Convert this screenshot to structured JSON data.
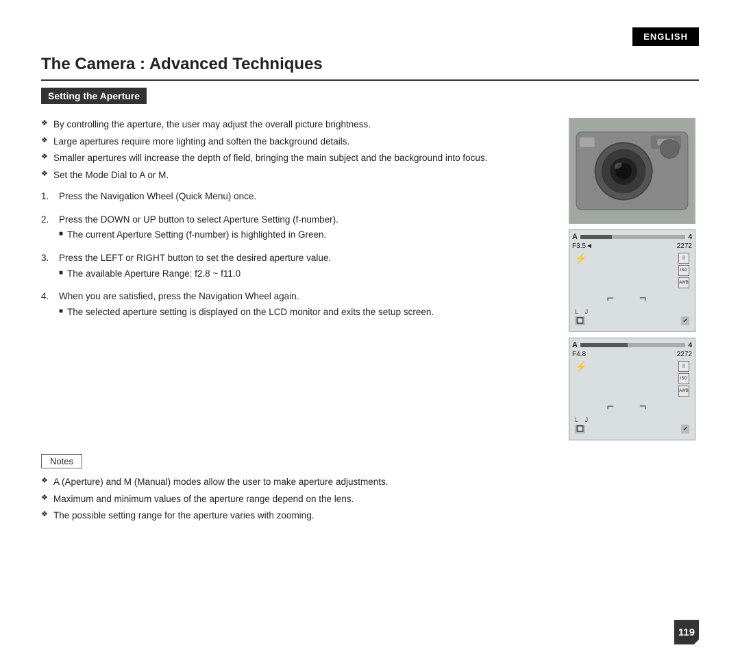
{
  "badge": {
    "label": "ENGLISH"
  },
  "page": {
    "title": "The Camera : Advanced Techniques",
    "section_heading": "Setting the Aperture"
  },
  "intro_bullets": [
    "By controlling the aperture, the user may adjust the overall picture brightness.",
    "Large apertures require more lighting and soften the background details.",
    "Smaller apertures will increase the depth of field, bringing the main subject and the background into focus.",
    "Set the Mode Dial to A or M."
  ],
  "steps": [
    {
      "num": "1.",
      "text": "Press the Navigation Wheel (Quick Menu) once.",
      "sub": null
    },
    {
      "num": "2.",
      "text": "Press the DOWN or UP button to select Aperture Setting (f-number).",
      "sub": "The current Aperture Setting (f-number) is highlighted in Green."
    },
    {
      "num": "3.",
      "text": "Press the LEFT or RIGHT button to set the desired aperture value.",
      "sub": "The available Aperture Range: f2.8 ~ f11.0"
    },
    {
      "num": "4.",
      "text": "When you are satisfied, press the Navigation Wheel again.",
      "sub": "The selected aperture setting is displayed on the LCD monitor and exits the setup screen."
    }
  ],
  "notes_label": "Notes",
  "notes_bullets": [
    "A (Aperture) and M (Manual) modes allow the user to make aperture adjustments.",
    "Maximum and minimum values of the aperture range depend on the lens.",
    "The possible setting range for the aperture varies with zooming."
  ],
  "lcd1": {
    "mode": "A",
    "bar_pct": 30,
    "number": "4",
    "fnum": "F3.5◄",
    "count": "2272",
    "iso_label": "ISO",
    "awb_label": "AWB"
  },
  "lcd2": {
    "mode": "A",
    "bar_pct": 45,
    "number": "4",
    "fnum": "F4.8",
    "count": "2272",
    "iso_label": "ISO",
    "awb_label": "AWB"
  },
  "page_number": "119"
}
